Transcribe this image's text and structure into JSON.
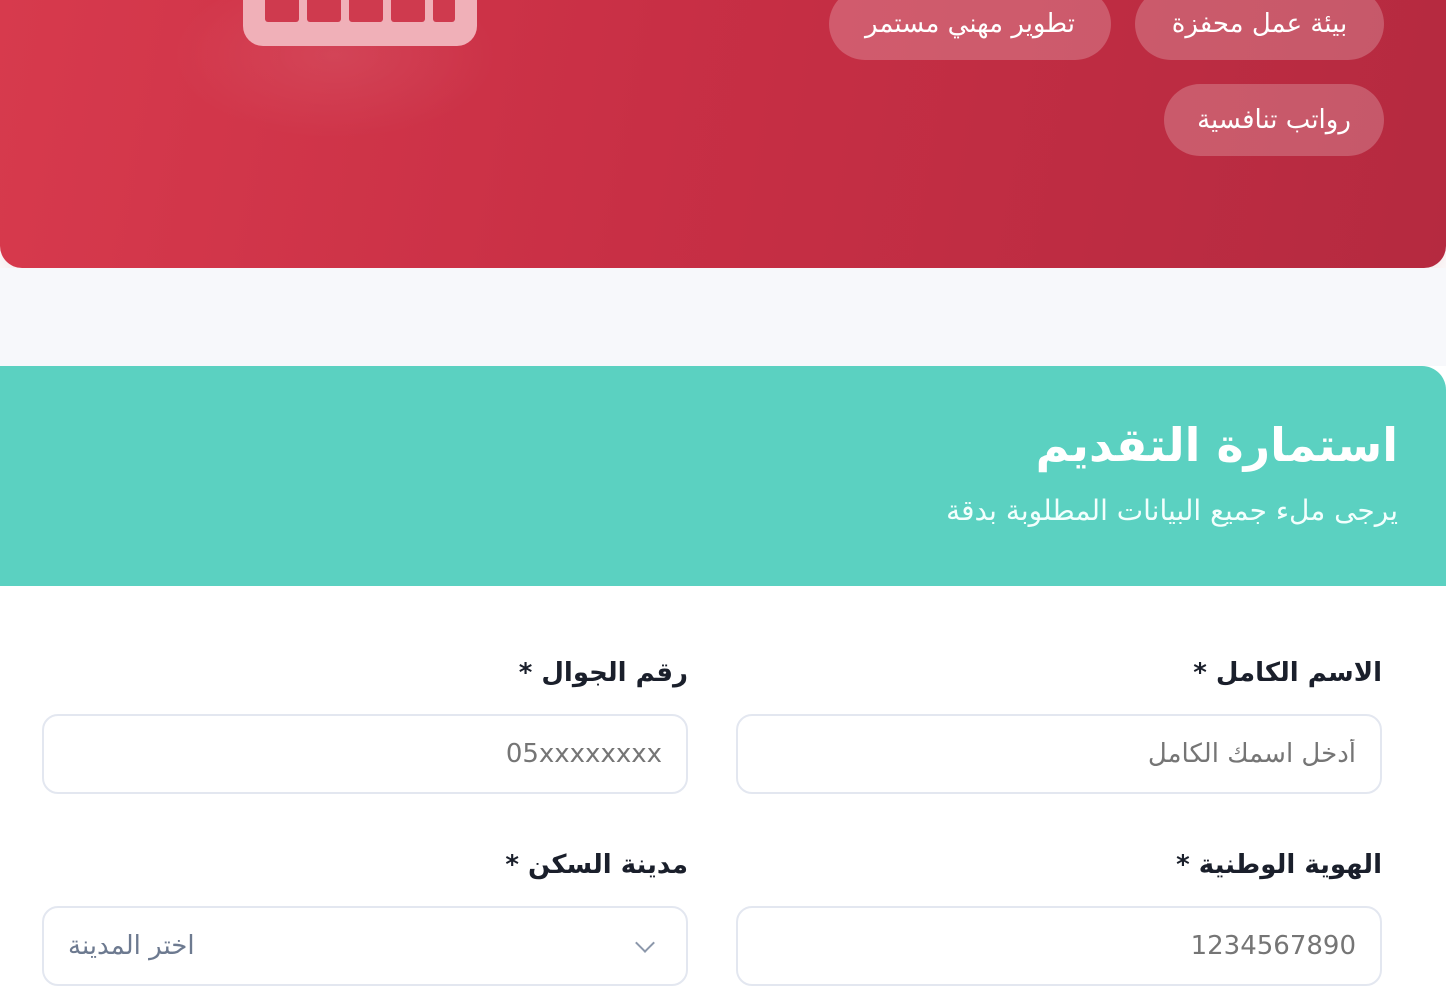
{
  "hero": {
    "badges": [
      "بيئة عمل محفزة",
      "تطوير مهني مستمر",
      "رواتب تنافسية"
    ],
    "colors": {
      "gradient_start": "#d73a4d",
      "gradient_end": "#b52a40"
    },
    "icon": "calendar-icon"
  },
  "form": {
    "title": "استمارة التقديم",
    "subtitle": "يرجى ملء جميع البيانات المطلوبة بدقة",
    "header_color": "#5bd1c1",
    "fields": {
      "full_name": {
        "label": "الاسم الكامل *",
        "placeholder": "أدخل اسمك الكامل"
      },
      "mobile": {
        "label": "رقم الجوال *",
        "placeholder": "05xxxxxxxx"
      },
      "national_id": {
        "label": "الهوية الوطنية *",
        "placeholder": "1234567890"
      },
      "city": {
        "label": "مدينة السكن *",
        "selected": "اختر المدينة",
        "icon": "chevron-down-icon"
      }
    }
  }
}
